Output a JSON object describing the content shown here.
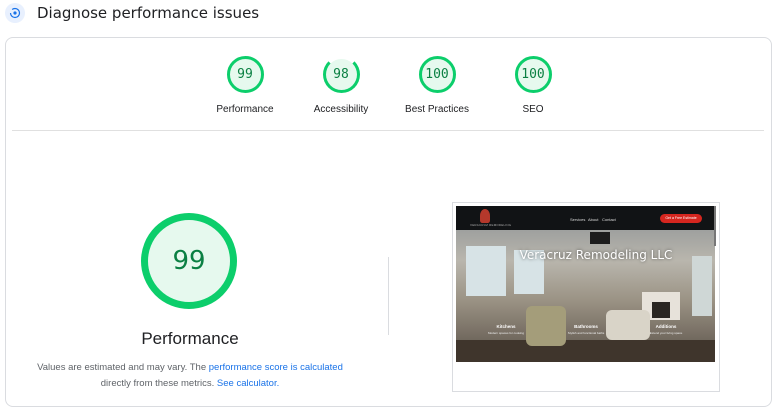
{
  "header": {
    "title": "Diagnose performance issues",
    "icon": "diagnose-icon"
  },
  "gauges": [
    {
      "score": "99",
      "label": "Performance"
    },
    {
      "score": "98",
      "label": "Accessibility"
    },
    {
      "score": "100",
      "label": "Best Practices"
    },
    {
      "score": "100",
      "label": "SEO"
    }
  ],
  "main": {
    "score": "99",
    "label": "Performance",
    "note": {
      "prefix": "Values are estimated and may vary. The ",
      "link1": "performance score is calculated",
      "middle": "directly from these metrics.",
      "link2": "See calculator."
    }
  },
  "screenshot": {
    "heading": "Veracruz Remodeling LLC",
    "logo_text": "VERACRUZ REMODELING",
    "nav": [
      "Services",
      "About",
      "Contact"
    ],
    "cta": "Get a Free Estimate",
    "features": [
      {
        "title": "Kitchens",
        "sub": "Modern spaces for cooking"
      },
      {
        "title": "Bathrooms",
        "sub": "Stylish and functional baths"
      },
      {
        "title": "Additions",
        "sub": "Extend your living space"
      }
    ]
  },
  "colors": {
    "pass": "#0cce6b",
    "pass_bg": "#e6f9ee",
    "pass_text": "#0b8043",
    "link": "#1a73e8"
  }
}
